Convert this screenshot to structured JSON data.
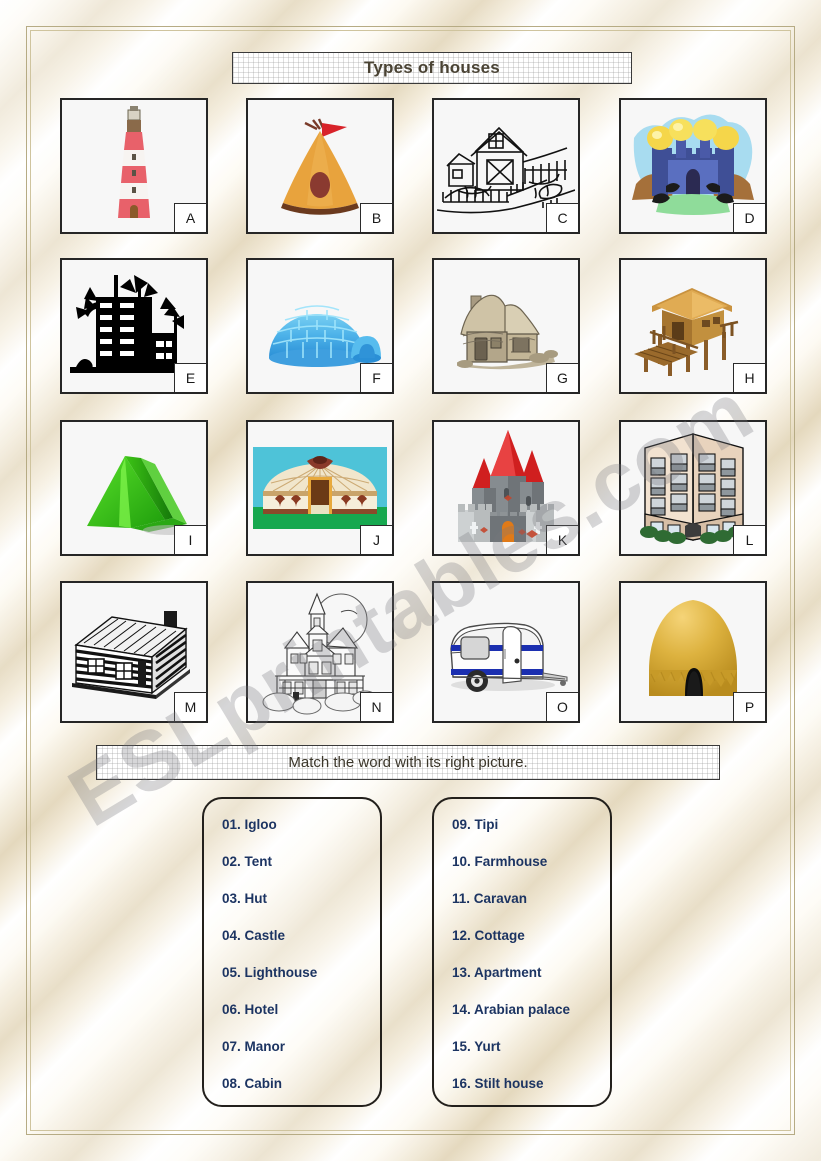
{
  "worksheet": {
    "title": "Types of houses",
    "instruction": "Match the word with its right picture.",
    "watermark": "ESLprintables.com"
  },
  "pictures": [
    {
      "letter": "A",
      "subject": "lighthouse-illustration"
    },
    {
      "letter": "B",
      "subject": "tipi-illustration"
    },
    {
      "letter": "C",
      "subject": "farmhouse-illustration"
    },
    {
      "letter": "D",
      "subject": "arabian-palace-illustration"
    },
    {
      "letter": "E",
      "subject": "hotel-silhouette-illustration"
    },
    {
      "letter": "F",
      "subject": "igloo-illustration"
    },
    {
      "letter": "G",
      "subject": "cottage-illustration"
    },
    {
      "letter": "H",
      "subject": "stilt-house-illustration"
    },
    {
      "letter": "I",
      "subject": "tent-illustration"
    },
    {
      "letter": "J",
      "subject": "yurt-illustration"
    },
    {
      "letter": "K",
      "subject": "castle-illustration"
    },
    {
      "letter": "L",
      "subject": "apartment-illustration"
    },
    {
      "letter": "M",
      "subject": "cabin-illustration"
    },
    {
      "letter": "N",
      "subject": "manor-illustration"
    },
    {
      "letter": "O",
      "subject": "caravan-illustration"
    },
    {
      "letter": "P",
      "subject": "hut-illustration"
    }
  ],
  "word_list": {
    "left_column": [
      "01. Igloo",
      "02. Tent",
      "03. Hut",
      "04. Castle",
      "05. Lighthouse",
      "06. Hotel",
      "07. Manor",
      "08. Cabin"
    ],
    "right_column": [
      "09. Tipi",
      "10. Farmhouse",
      "11. Caravan",
      "12. Cottage",
      "13. Apartment",
      "14. Arabian palace",
      "15. Yurt",
      "16. Stilt house"
    ]
  },
  "colors": {
    "title_text": "#4a4334",
    "word_text": "#1c3462",
    "card_border": "#262626",
    "frame_border": "#b6ab84"
  }
}
